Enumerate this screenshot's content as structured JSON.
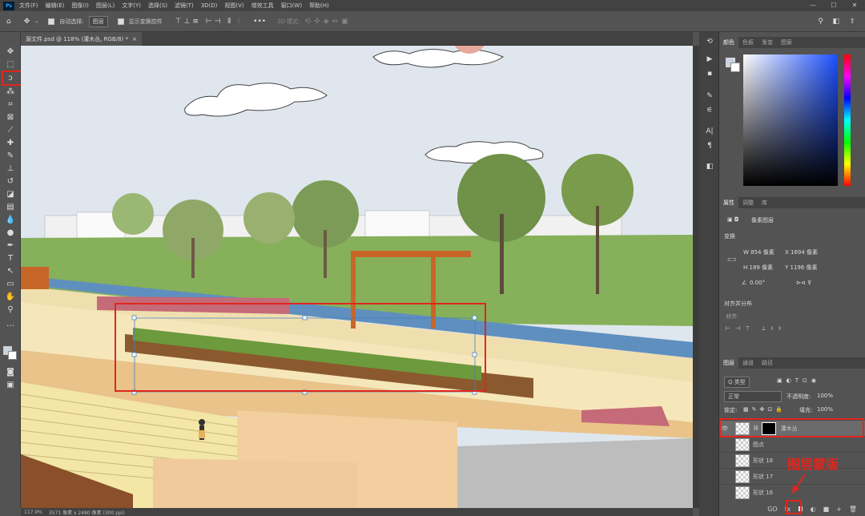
{
  "app": {
    "logo": "Ps"
  },
  "menu": [
    "文件(F)",
    "编辑(E)",
    "图像(I)",
    "图层(L)",
    "文字(Y)",
    "选择(S)",
    "滤镜(T)",
    "3D(D)",
    "视图(V)",
    "增效工具",
    "窗口(W)",
    "帮助(H)"
  ],
  "options": {
    "auto_select": "自动选择:",
    "layer_select": "图层",
    "show_transform": "显示变换控件",
    "mode_3d": "3D 模式:",
    "dots": "•••"
  },
  "document": {
    "tab": "源文件.psd @ 118% (灌木丛, RGB/8) *",
    "close": "×"
  },
  "status": {
    "zoom": "117.9%",
    "size": "3571 像素 x 2480 像素 (300 ppi)"
  },
  "color_panel": {
    "tabs": [
      "颜色",
      "色板",
      "渐变",
      "图案"
    ]
  },
  "properties_panel": {
    "tabs": [
      "属性",
      "调整",
      "库"
    ],
    "kind": "像素图层",
    "transform_title": "变换",
    "w": "W  854 像素",
    "x": "X  1694 像素",
    "h": "H  189 像素",
    "y": "Y  1196 像素",
    "angle": "0.00°",
    "align_title": "对齐并分布",
    "align_label": "对齐:"
  },
  "layers_panel": {
    "tabs": [
      "图层",
      "通道",
      "路径"
    ],
    "filter": "Q 类型",
    "blend": "正常",
    "opacity_label": "不透明度:",
    "opacity": "100%",
    "lock_label": "锁定:",
    "fill_label": "填充:",
    "fill": "100%",
    "layers": [
      {
        "name": "灌木丛",
        "visible": true,
        "selected": true
      },
      {
        "name": "图点",
        "visible": false,
        "selected": false
      },
      {
        "name": "形状 18",
        "visible": false,
        "selected": false
      },
      {
        "name": "形状 17",
        "visible": false,
        "selected": false
      },
      {
        "name": "形状 16",
        "visible": false,
        "selected": false
      }
    ],
    "footer": [
      "GO",
      "fx",
      "◘",
      "◐",
      "■",
      "+",
      "🗑"
    ]
  },
  "annotation": {
    "label": "图层蒙版",
    "color": "#e0261e"
  }
}
